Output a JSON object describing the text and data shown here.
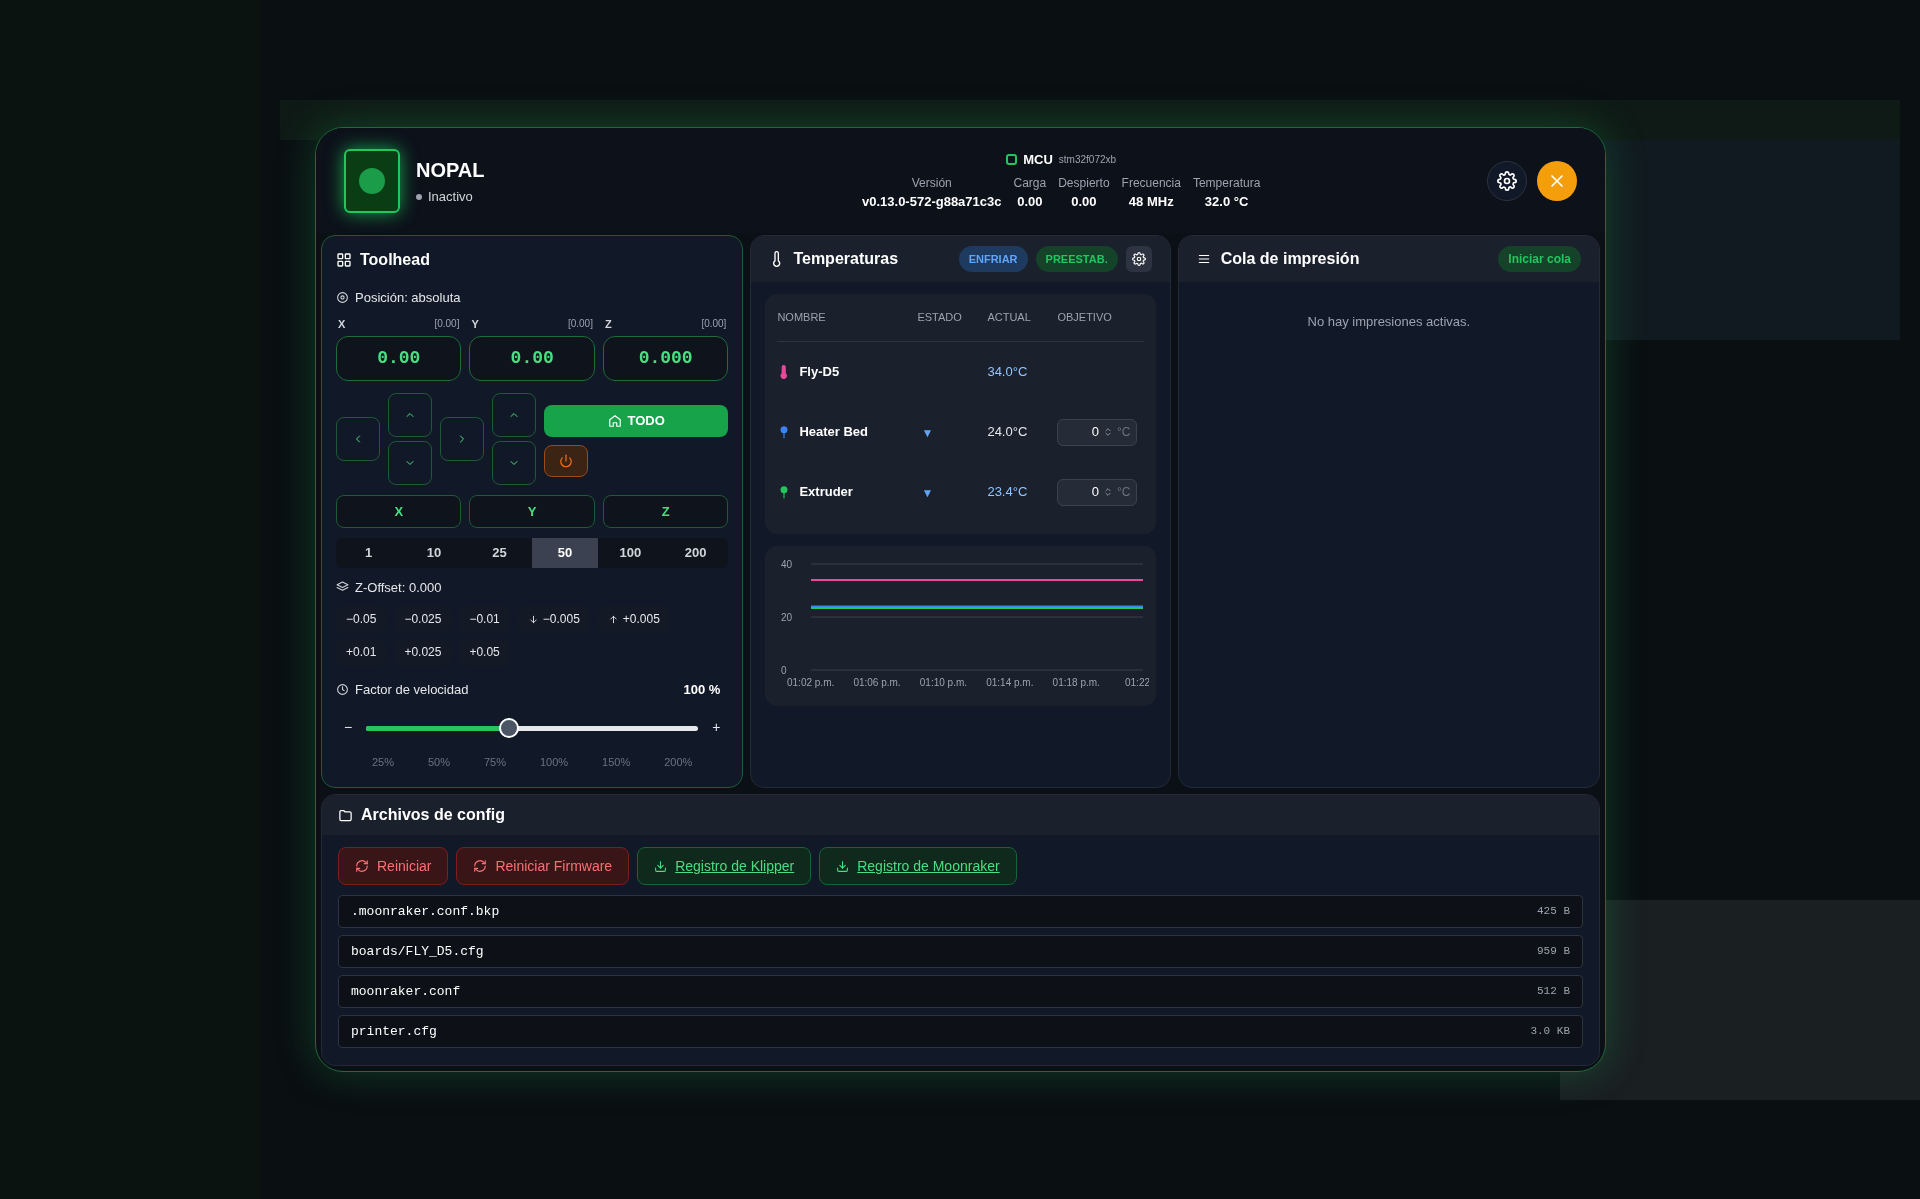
{
  "printer": {
    "name": "NOPAL",
    "status": "Inactivo"
  },
  "mcu": {
    "label": "MCU",
    "chip": "stm32f072xb",
    "stats": [
      {
        "label": "Versión",
        "value": "v0.13.0-572-g88a71c3c"
      },
      {
        "label": "Carga",
        "value": "0.00"
      },
      {
        "label": "Despierto",
        "value": "0.00"
      },
      {
        "label": "Frecuencia",
        "value": "48 MHz"
      },
      {
        "label": "Temperatura",
        "value": "32.0 °C"
      }
    ]
  },
  "toolhead": {
    "title": "Toolhead",
    "position_mode": "Posición: absoluta",
    "axes": [
      {
        "label": "X",
        "offset": "[0.00]",
        "value": "0.00"
      },
      {
        "label": "Y",
        "offset": "[0.00]",
        "value": "0.00"
      },
      {
        "label": "Z",
        "offset": "[0.00]",
        "value": "0.000"
      }
    ],
    "home_all": "TODO",
    "home_axes": [
      "X",
      "Y",
      "Z"
    ],
    "steps": [
      {
        "label": "1",
        "selected": false
      },
      {
        "label": "10",
        "selected": false
      },
      {
        "label": "25",
        "selected": false
      },
      {
        "label": "50",
        "selected": true
      },
      {
        "label": "100",
        "selected": false
      },
      {
        "label": "200",
        "selected": false
      }
    ],
    "z_offset": "Z-Offset: 0.000",
    "z_buttons": [
      {
        "label": "−0.05",
        "kind": "plain"
      },
      {
        "label": "−0.025",
        "kind": "plain"
      },
      {
        "label": "−0.01",
        "kind": "plain"
      },
      {
        "label": "−0.005",
        "kind": "down"
      },
      {
        "label": "+0.005",
        "kind": "up"
      },
      {
        "label": "+0.01",
        "kind": "plain"
      },
      {
        "label": "+0.025",
        "kind": "plain"
      },
      {
        "label": "+0.05",
        "kind": "plain"
      }
    ],
    "speed": {
      "label": "Factor de velocidad",
      "reading": "100 %",
      "level": 0.43,
      "minus": "−",
      "plus": "+",
      "ticks": [
        "25%",
        "50%",
        "75%",
        "100%",
        "150%",
        "200%"
      ]
    }
  },
  "temperatures": {
    "title": "Temperaturas",
    "cool_button": "ENFRIAR",
    "preset_button": "PREESTAB.",
    "columns": [
      "NOMBRE",
      "ESTADO",
      "ACTUAL",
      "OBJETIVO"
    ],
    "rows": [
      {
        "kind": "sensor",
        "name": "Fly-D5",
        "color": "#ec4899",
        "actual": "34.0°C"
      },
      {
        "kind": "heater",
        "name": "Heater Bed",
        "color": "#3b82f6",
        "state": "▼",
        "actual": "24.0°C",
        "target": "0",
        "unit": "°C"
      },
      {
        "kind": "heater",
        "name": "Extruder",
        "color": "#22c55e",
        "state": "▼",
        "actual": "23.4°C",
        "target": "0",
        "unit": "°C"
      }
    ],
    "chart_data": {
      "type": "line",
      "x": [
        "01:02 p.m.",
        "01:06 p.m.",
        "01:10 p.m.",
        "01:14 p.m.",
        "01:18 p.m.",
        "01:22"
      ],
      "ylim": [
        0,
        40
      ],
      "yticks": [
        0,
        20,
        40
      ],
      "series": [
        {
          "color": "#ec4899",
          "values": [
            34,
            34,
            34,
            34,
            34,
            34
          ]
        },
        {
          "color": "#3b82f6",
          "values": [
            24,
            24,
            24,
            24,
            24,
            24
          ]
        },
        {
          "color": "#22c55e",
          "values": [
            23.4,
            23.4,
            23.4,
            23.4,
            23.4,
            23.4
          ]
        }
      ]
    }
  },
  "queue": {
    "title": "Cola de impresión",
    "start_button": "Iniciar cola",
    "empty": "No hay impresiones activas."
  },
  "config": {
    "title": "Archivos de config",
    "buttons": [
      {
        "label": "Reiniciar",
        "kind": "danger"
      },
      {
        "label": "Reiniciar Firmware",
        "kind": "danger"
      },
      {
        "label": "Registro de Klipper",
        "kind": "download"
      },
      {
        "label": "Registro de Moonraker",
        "kind": "download"
      }
    ],
    "files": [
      {
        "name": ".moonraker.conf.bkp",
        "size": "425 B"
      },
      {
        "name": "boards/FLY_D5.cfg",
        "size": "959 B"
      },
      {
        "name": "moonraker.conf",
        "size": "512 B"
      },
      {
        "name": "printer.cfg",
        "size": "3.0 KB"
      }
    ]
  }
}
